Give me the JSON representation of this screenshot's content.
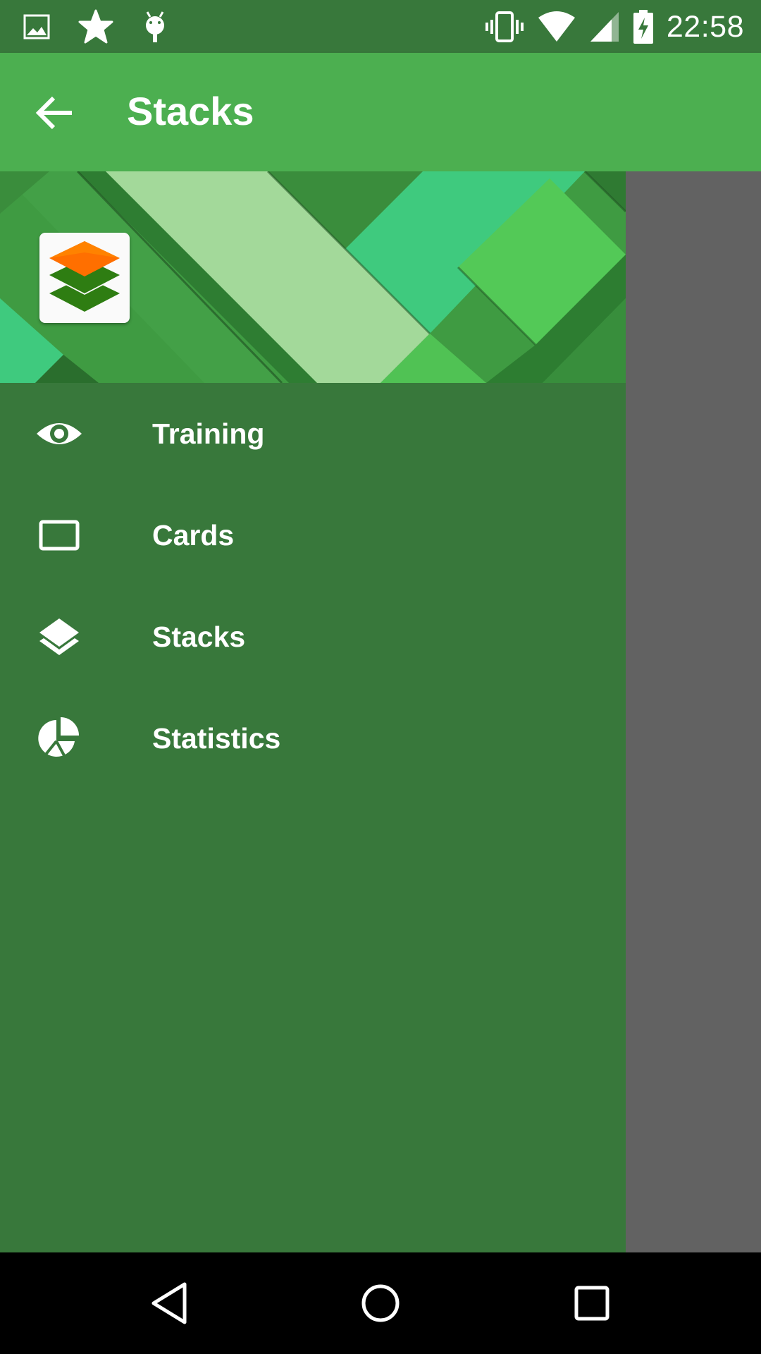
{
  "status_bar": {
    "time": "22:58",
    "left_icons": [
      "image-icon",
      "star-icon",
      "android-icon"
    ],
    "right_icons": [
      "vibrate-icon",
      "wifi-icon",
      "signal-icon",
      "battery-charging-icon"
    ]
  },
  "app_bar": {
    "title": "Stacks",
    "back_icon": "arrow-back-icon"
  },
  "drawer": {
    "header_logo": "stacks-app-logo",
    "items": [
      {
        "label": "Training",
        "icon": "eye-icon"
      },
      {
        "label": "Cards",
        "icon": "card-icon"
      },
      {
        "label": "Stacks",
        "icon": "layers-icon"
      },
      {
        "label": "Statistics",
        "icon": "pie-chart-icon"
      }
    ]
  },
  "nav_bar": {
    "buttons": [
      "back-triangle-icon",
      "home-circle-icon",
      "recents-square-icon"
    ]
  },
  "colors": {
    "status_bar": "#38783b",
    "app_bar": "#4caf50",
    "drawer": "#38783b",
    "scrim": "#626262",
    "logo_orange": "#ff6f00",
    "logo_green": "#2e7d12"
  }
}
